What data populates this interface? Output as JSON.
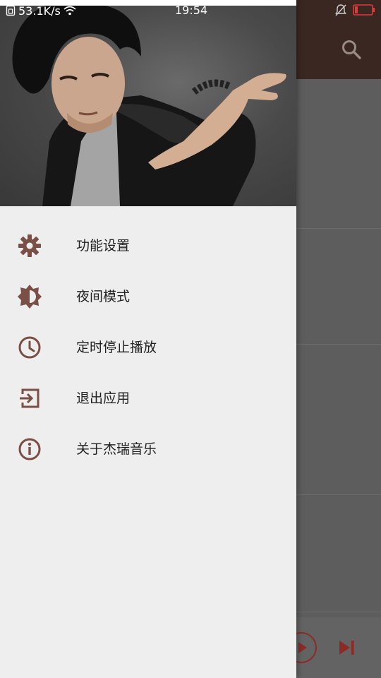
{
  "status_bar": {
    "net_speed": "53.1K/s",
    "time": "19:54"
  },
  "colors": {
    "accent_brown": "#7a4f45",
    "toolbar_dark": "#3b2722",
    "player_red": "#b3261e"
  },
  "header": {
    "image": "artist-portrait-icon"
  },
  "background_app": {
    "search_icon": "search-icon",
    "play_icon": "play-circle-icon",
    "next_icon": "skip-next-icon"
  },
  "menu": {
    "items": [
      {
        "label": "功能设置",
        "icon": "settings-gear-icon"
      },
      {
        "label": "夜间模式",
        "icon": "brightness-icon"
      },
      {
        "label": "定时停止播放",
        "icon": "clock-icon"
      },
      {
        "label": "退出应用",
        "icon": "exit-icon"
      },
      {
        "label": "关于杰瑞音乐",
        "icon": "info-icon"
      }
    ]
  }
}
